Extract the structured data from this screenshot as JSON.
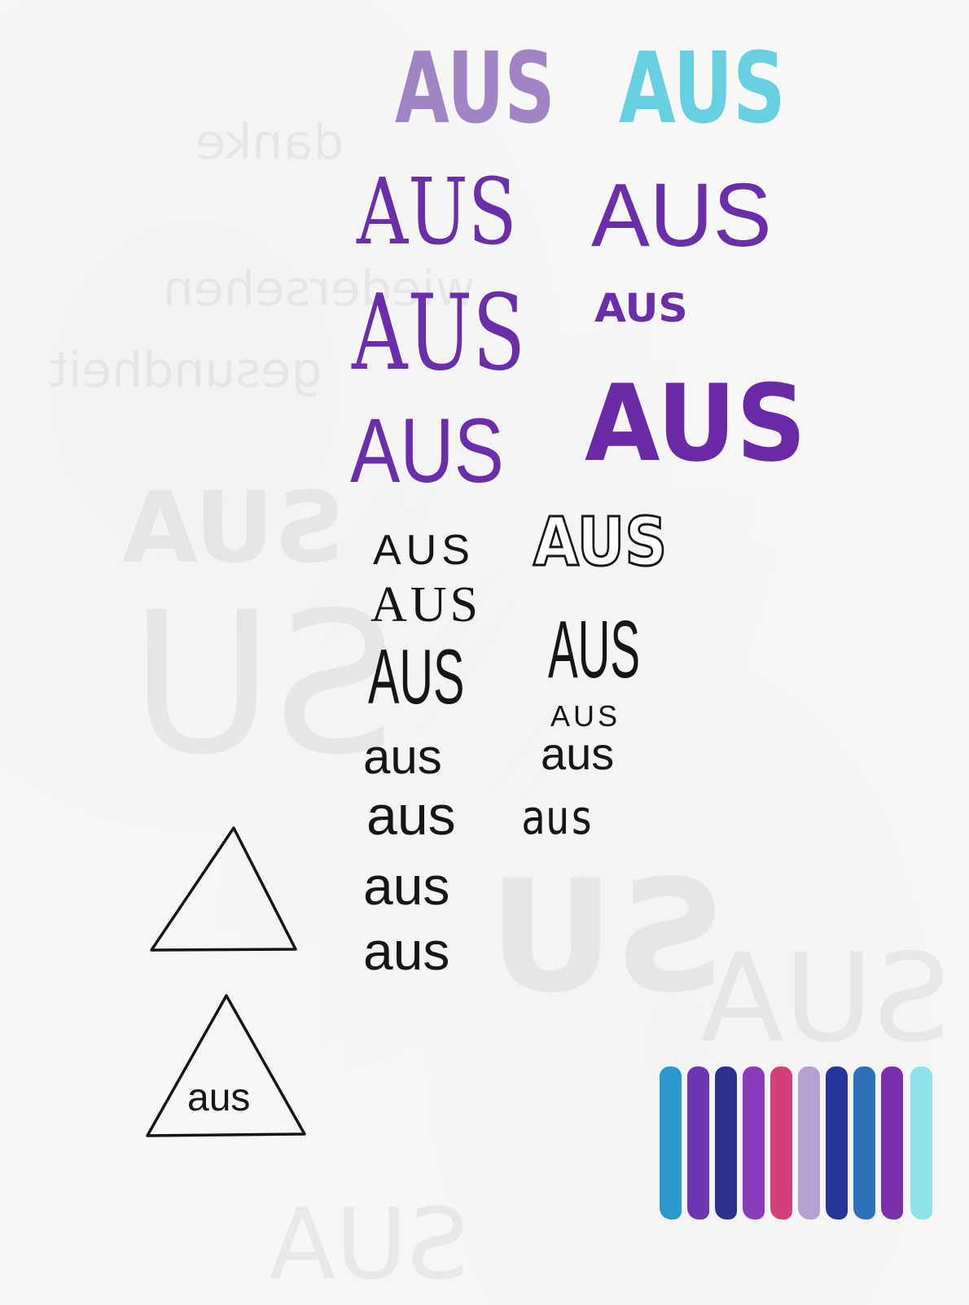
{
  "rows": {
    "r1_left": "AUS",
    "r1_right": "AUS",
    "r2_left": "AUS",
    "r2_right": "AUS",
    "r3_left": "AUS",
    "r3_right": "AUS",
    "r4_left": "AUS",
    "r4_right": "AUS",
    "r5_left": "AUS",
    "r5_right": "AUS",
    "r6_left": "AUS",
    "r7_left": "AUS",
    "r7_right": "AUS",
    "r8_right": "AUS",
    "r9_left": "aus",
    "r9_right": "aus",
    "r10_left": "aus",
    "r10_right": "aus",
    "r11_left": "aus",
    "r12_left": "aus"
  },
  "triangle_label": "aus",
  "colors": {
    "light_purple": "#a184c6",
    "light_cyan": "#66cfe0",
    "purple": "#6a2fa8",
    "deep_purple": "#6a2aa6",
    "ink": "#151515"
  },
  "swatch_colors": [
    "#2a97cf",
    "#6e34b4",
    "#2d2f8f",
    "#8a3cb8",
    "#d2407c",
    "#b3a2cf",
    "#26349a",
    "#2f71b8",
    "#7a2fab",
    "#8ee3ea"
  ]
}
